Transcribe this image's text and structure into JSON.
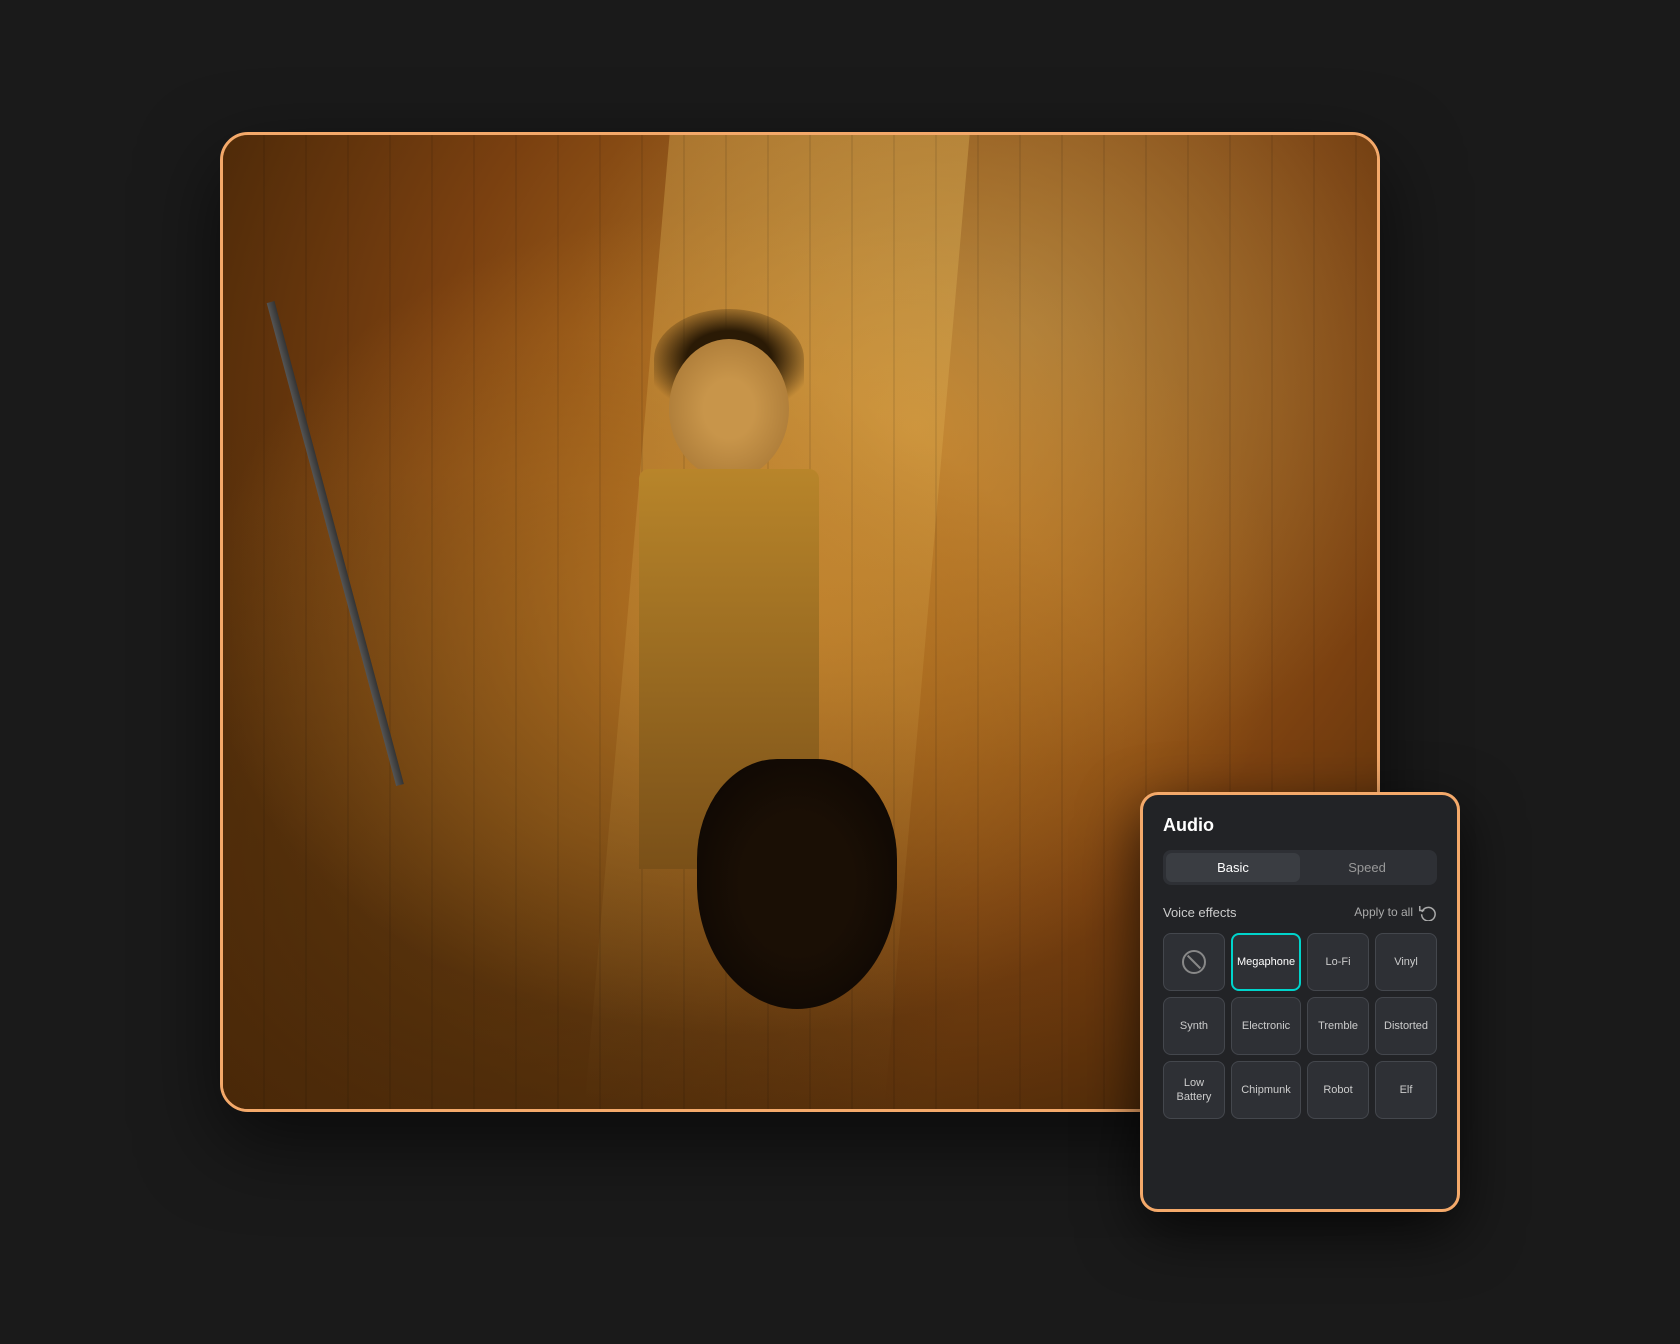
{
  "panel": {
    "title": "Audio",
    "tabs": [
      {
        "label": "Basic",
        "active": true
      },
      {
        "label": "Speed",
        "active": false
      }
    ],
    "voice_effects": {
      "section_label": "Voice effects",
      "apply_all_label": "Apply to all",
      "effects": [
        {
          "id": "none",
          "label": "",
          "type": "no-effect",
          "active": false
        },
        {
          "id": "megaphone",
          "label": "Megaphone",
          "type": "effect",
          "active": true
        },
        {
          "id": "lofi",
          "label": "Lo-Fi",
          "type": "effect",
          "active": false
        },
        {
          "id": "vinyl",
          "label": "Vinyl",
          "type": "effect",
          "active": false
        },
        {
          "id": "synth",
          "label": "Synth",
          "type": "effect",
          "active": false
        },
        {
          "id": "electronic",
          "label": "Electronic",
          "type": "effect",
          "active": false
        },
        {
          "id": "tremble",
          "label": "Tremble",
          "type": "effect",
          "active": false
        },
        {
          "id": "distorted",
          "label": "Distorted",
          "type": "effect",
          "active": false
        },
        {
          "id": "low-battery",
          "label": "Low Battery",
          "type": "effect",
          "active": false
        },
        {
          "id": "chipmunk",
          "label": "Chipmunk",
          "type": "effect",
          "active": false
        },
        {
          "id": "robot",
          "label": "Robot",
          "type": "effect",
          "active": false
        },
        {
          "id": "elf",
          "label": "Elf",
          "type": "effect",
          "active": false
        }
      ]
    }
  },
  "colors": {
    "accent": "#f4a96a",
    "active_border": "#00d4cc",
    "panel_bg": "#222326"
  }
}
